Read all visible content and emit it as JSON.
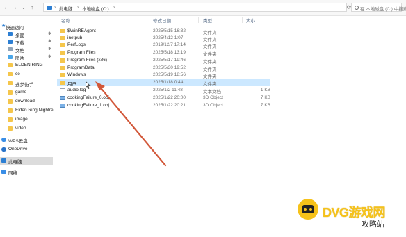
{
  "address_bar": {
    "crumb_1": "此电脑",
    "crumb_2": "本地磁盘 (C:)",
    "search_placeholder": "在 本地磁盘 (C:) 中搜索"
  },
  "sidebar": {
    "items": [
      {
        "label": "快速访问",
        "icon": "star-icon"
      },
      {
        "label": "桌面",
        "icon": "desktop-icon"
      },
      {
        "label": "下载",
        "icon": "download-icon"
      },
      {
        "label": "文档",
        "icon": "document-icon"
      },
      {
        "label": "图片",
        "icon": "picture-icon"
      },
      {
        "label": "ELDEN RING",
        "icon": "folder-icon"
      },
      {
        "label": "ce",
        "icon": "folder-icon"
      },
      {
        "label": "逃梦街手",
        "icon": "folder-icon"
      },
      {
        "label": "game",
        "icon": "folder-icon"
      },
      {
        "label": "download",
        "icon": "folder-icon"
      },
      {
        "label": "Elden.Ring.Nightre",
        "icon": "folder-icon"
      },
      {
        "label": "image",
        "icon": "folder-icon"
      },
      {
        "label": "video",
        "icon": "folder-icon"
      },
      {
        "label": "WPS云盘",
        "icon": "cloud-icon"
      },
      {
        "label": "OneDrive",
        "icon": "cloud-icon"
      },
      {
        "label": "此电脑",
        "icon": "computer-icon"
      },
      {
        "label": "网络",
        "icon": "network-icon"
      }
    ]
  },
  "columns": {
    "name": "名称",
    "date": "修改日期",
    "type": "类型",
    "size": "大小"
  },
  "files": [
    {
      "name": "$WinREAgent",
      "date": "2025/5/15 16:32",
      "type": "文件夹",
      "size": "",
      "kind": "folder"
    },
    {
      "name": "inetpub",
      "date": "2025/4/12 1:07",
      "type": "文件夹",
      "size": "",
      "kind": "folder"
    },
    {
      "name": "PerfLogs",
      "date": "2019/12/7 17:14",
      "type": "文件夹",
      "size": "",
      "kind": "folder"
    },
    {
      "name": "Program Files",
      "date": "2025/5/18 13:19",
      "type": "文件夹",
      "size": "",
      "kind": "folder"
    },
    {
      "name": "Program Files (x86)",
      "date": "2025/5/17 19:46",
      "type": "文件夹",
      "size": "",
      "kind": "folder"
    },
    {
      "name": "ProgramData",
      "date": "2025/5/30 19:52",
      "type": "文件夹",
      "size": "",
      "kind": "folder"
    },
    {
      "name": "Windows",
      "date": "2025/5/19 18:56",
      "type": "文件夹",
      "size": "",
      "kind": "folder"
    },
    {
      "name": "用户",
      "date": "2025/1/18 0:44",
      "type": "文件夹",
      "size": "",
      "kind": "folder"
    },
    {
      "name": "audio.log",
      "date": "2025/1/2 11:48",
      "type": "文本文档",
      "size": "1 KB",
      "kind": "text"
    },
    {
      "name": "cookingFailure_0.obj",
      "date": "2025/1/22 20:00",
      "type": "3D Object",
      "size": "7 KB",
      "kind": "obj"
    },
    {
      "name": "cookingFailure_1.obj",
      "date": "2025/1/22 20:21",
      "type": "3D Object",
      "size": "7 KB",
      "kind": "obj"
    }
  ],
  "watermark": {
    "brand": "DVG游戏网",
    "sub": "攻略站"
  },
  "colors": {
    "selection": "#cce8ff",
    "folder": "#f5c64b",
    "arrow": "#d2583a",
    "watermark": "#f6c21a"
  }
}
